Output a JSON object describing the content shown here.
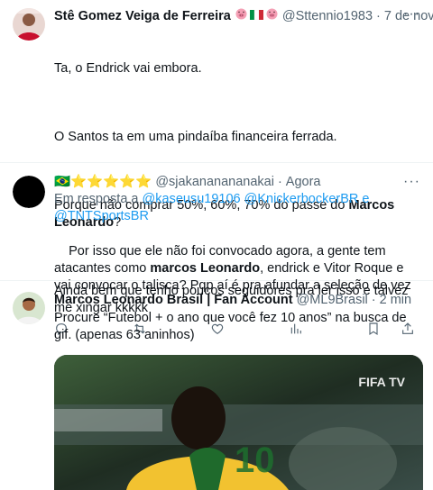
{
  "tweets": [
    {
      "name": "Stê Gomez Veiga de Ferreira",
      "handle": "@Sttennio1983",
      "time": "7 de nov",
      "paragraphs": [
        "Ta, o Endrick vai embora.",
        "O Santos ta em uma pindaíba financeira ferrada.",
        [
          "Porque não comprar 50%, 60%, 70% do passe do ",
          "Marcos Leonardo",
          "?"
        ],
        "Ainda bem que tenho poucos seguidores pra ler isso e talvez me xingar kkkkk"
      ]
    },
    {
      "name_emoji": "🇧🇷⭐⭐⭐⭐⭐",
      "handle": "@sjakananananakai",
      "time": "Agora",
      "reply_prefix": "Em resposta a",
      "reply_handles": [
        "@kaseusu19106",
        "@KnickerbockerBR",
        "@TNTSportsBR"
      ],
      "reply_conjunction": "e",
      "text_parts": [
        "Por isso que ele não foi convocado agora, a gente tem atacantes como ",
        "marcos Leonardo",
        ", endrick e Vitor Roque e vai convocar o talisca? Pqp aí é pra afundar a seleção de vez"
      ]
    },
    {
      "name": "Marcos Leonardo Brasil | Fan Account",
      "handle": "@ML9Brasil",
      "time": "2 min",
      "text": "Procure “Futebol + o ano que você fez 10 anos” na busca de gif. (apenas 63 aninhos)",
      "media_watermark": "FIFA TV",
      "media_overlay": "10"
    }
  ],
  "icons": [
    "reply-icon",
    "retweet-icon",
    "like-icon",
    "views-icon",
    "bookmark-icon",
    "share-icon",
    "more-icon"
  ]
}
